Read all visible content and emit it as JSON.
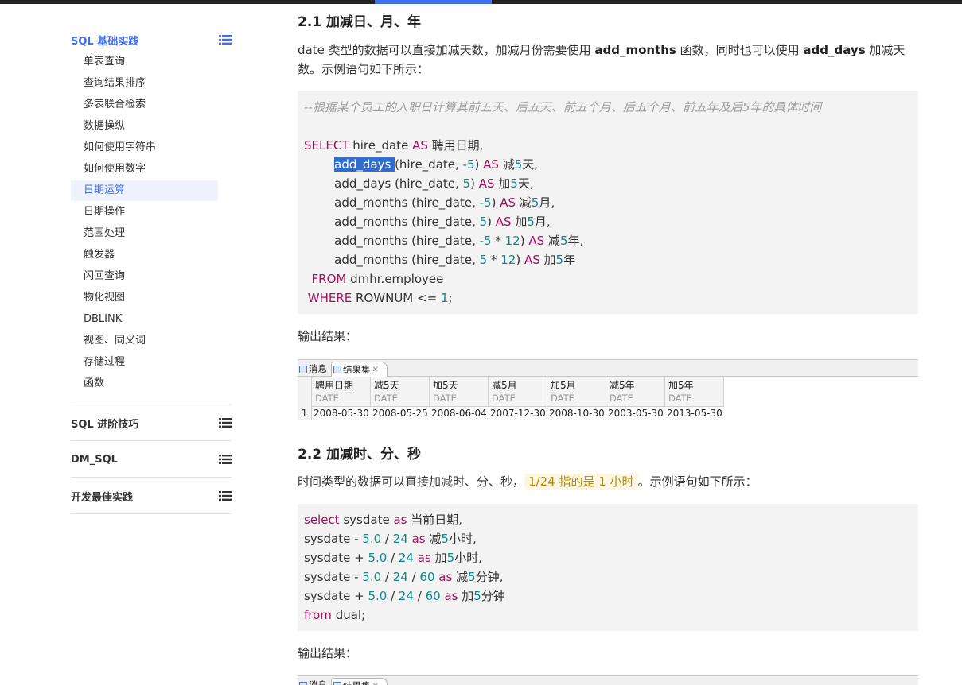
{
  "sidebar": {
    "sections": [
      {
        "title": "SQL 基础实践",
        "items": [
          "单表查询",
          "查询结果排序",
          "多表联合检索",
          "数据操纵",
          "如何使用字符串",
          "如何使用数字",
          "日期运算",
          "日期操作",
          "范围处理",
          "触发器",
          "闪回查询",
          "物化视图",
          "DBLINK",
          "视图、同义词",
          "存储过程",
          "函数"
        ],
        "selected": "日期运算"
      },
      {
        "title": "SQL 进阶技巧"
      },
      {
        "title": "DM_SQL"
      },
      {
        "title": "开发最佳实践"
      }
    ],
    "colors": {
      "accent": "#3e6ff0",
      "selected_bg": "#eef2fd"
    }
  },
  "main": {
    "sec1": {
      "heading": "2.1 加减日、月、年",
      "para_a": "date 类型的数据可以直接加减天数，加减月份需要使用 ",
      "para_b": "add_months",
      "para_c": " 函数，同时也可以使用 ",
      "para_d": "add_days",
      "para_e": " 加减天数。示例语句如下所示：",
      "code": {
        "comment": "--根据某个员工的入职日计算其前五天、后五天、前五个月、后五个月、前五年及后5年的具体时间",
        "l1_kw": "SELECT",
        "l1_t": " hire_date ",
        "l1_kw2": "AS",
        "l1_t2": " 聘用日期,",
        "l2_hl": "add_days ",
        "l2_t": "(hire_date, ",
        "l2_n": "-5",
        "l2_t2": ") ",
        "l2_kw": "AS",
        "l2_t3": " 减",
        "l2_n2": "5",
        "l2_t4": "天,",
        "l3_t": "add_days (hire_date, ",
        "l3_n": "5",
        "l3_t2": ") ",
        "l3_kw": "AS",
        "l3_t3": " 加",
        "l3_n2": "5",
        "l3_t4": "天,",
        "l4_t": "add_months (hire_date, ",
        "l4_n": "-5",
        "l4_t2": ") ",
        "l4_kw": "AS",
        "l4_t3": " 减",
        "l4_n2": "5",
        "l4_t4": "月,",
        "l5_t": "add_months (hire_date, ",
        "l5_n": "5",
        "l5_t2": ") ",
        "l5_kw": "AS",
        "l5_t3": " 加",
        "l5_n2": "5",
        "l5_t4": "月,",
        "l6_t": "add_months (hire_date, ",
        "l6_n": "-5",
        "l6_t2": " * ",
        "l6_n3": "12",
        "l6_t5": ") ",
        "l6_kw": "AS",
        "l6_t3": " 减",
        "l6_n2": "5",
        "l6_t4": "年,",
        "l7_t": "add_months (hire_date, ",
        "l7_n": "5",
        "l7_t2": " * ",
        "l7_n3": "12",
        "l7_t5": ") ",
        "l7_kw": "AS",
        "l7_t3": " 加",
        "l7_n2": "5",
        "l7_t4": "年",
        "l8_kw": "FROM",
        "l8_t": " dmhr.employee",
        "l9_kw": "WHERE",
        "l9_t": " ROWNUM <= ",
        "l9_n": "1",
        "l9_t2": ";"
      },
      "output_label": "输出结果：",
      "result": {
        "tabs": [
          "消息",
          "结果集"
        ],
        "columns": [
          {
            "name": "聘用日期",
            "type": "DATE"
          },
          {
            "name": "减5天",
            "type": "DATE"
          },
          {
            "name": "加5天",
            "type": "DATE"
          },
          {
            "name": "减5月",
            "type": "DATE"
          },
          {
            "name": "加5月",
            "type": "DATE"
          },
          {
            "name": "减5年",
            "type": "DATE"
          },
          {
            "name": "加5年",
            "type": "DATE"
          }
        ],
        "row_num": "1",
        "row": [
          "2008-05-30",
          "2008-05-25",
          "2008-06-04",
          "2007-12-30",
          "2008-10-30",
          "2003-05-30",
          "2013-05-30"
        ]
      }
    },
    "sec2": {
      "heading": "2.2 加减时、分、秒",
      "para_a": "时间类型的数据可以直接加减时、分、秒，",
      "inline_code": "1/24 指的是 1 小时",
      "para_b": "。示例语句如下所示：",
      "code": {
        "l1_kw": "select",
        "l1_t": " sysdate ",
        "l1_kw2": "as",
        "l1_t2": " 当前日期,",
        "l2_t": "sysdate - ",
        "l2_n": "5.0",
        "l2_t2": " / ",
        "l2_n2": "24",
        "l2_t3": " ",
        "l2_kw": "as",
        "l2_t4": " 减",
        "l2_n3": "5",
        "l2_t5": "小时,",
        "l3_t": "sysdate + ",
        "l3_n": "5.0",
        "l3_t2": " / ",
        "l3_n2": "24",
        "l3_t3": " ",
        "l3_kw": "as",
        "l3_t4": " 加",
        "l3_n3": "5",
        "l3_t5": "小时,",
        "l4_t": "sysdate - ",
        "l4_n": "5.0",
        "l4_t2": " / ",
        "l4_n2": "24",
        "l4_t3": " / ",
        "l4_n4": "60",
        "l4_t6": " ",
        "l4_kw": "as",
        "l4_t4": " 减",
        "l4_n3": "5",
        "l4_t5": "分钟,",
        "l5_t": "sysdate + ",
        "l5_n": "5.0",
        "l5_t2": " / ",
        "l5_n2": "24",
        "l5_t3": " / ",
        "l5_n4": "60",
        "l5_t6": " ",
        "l5_kw": "as",
        "l5_t4": " 加",
        "l5_n3": "5",
        "l5_t5": "分钟",
        "l6_kw": "from",
        "l6_t": " dual;"
      },
      "output_label": "输出结果：",
      "result_tabs": [
        "消息",
        "结果集"
      ]
    }
  }
}
